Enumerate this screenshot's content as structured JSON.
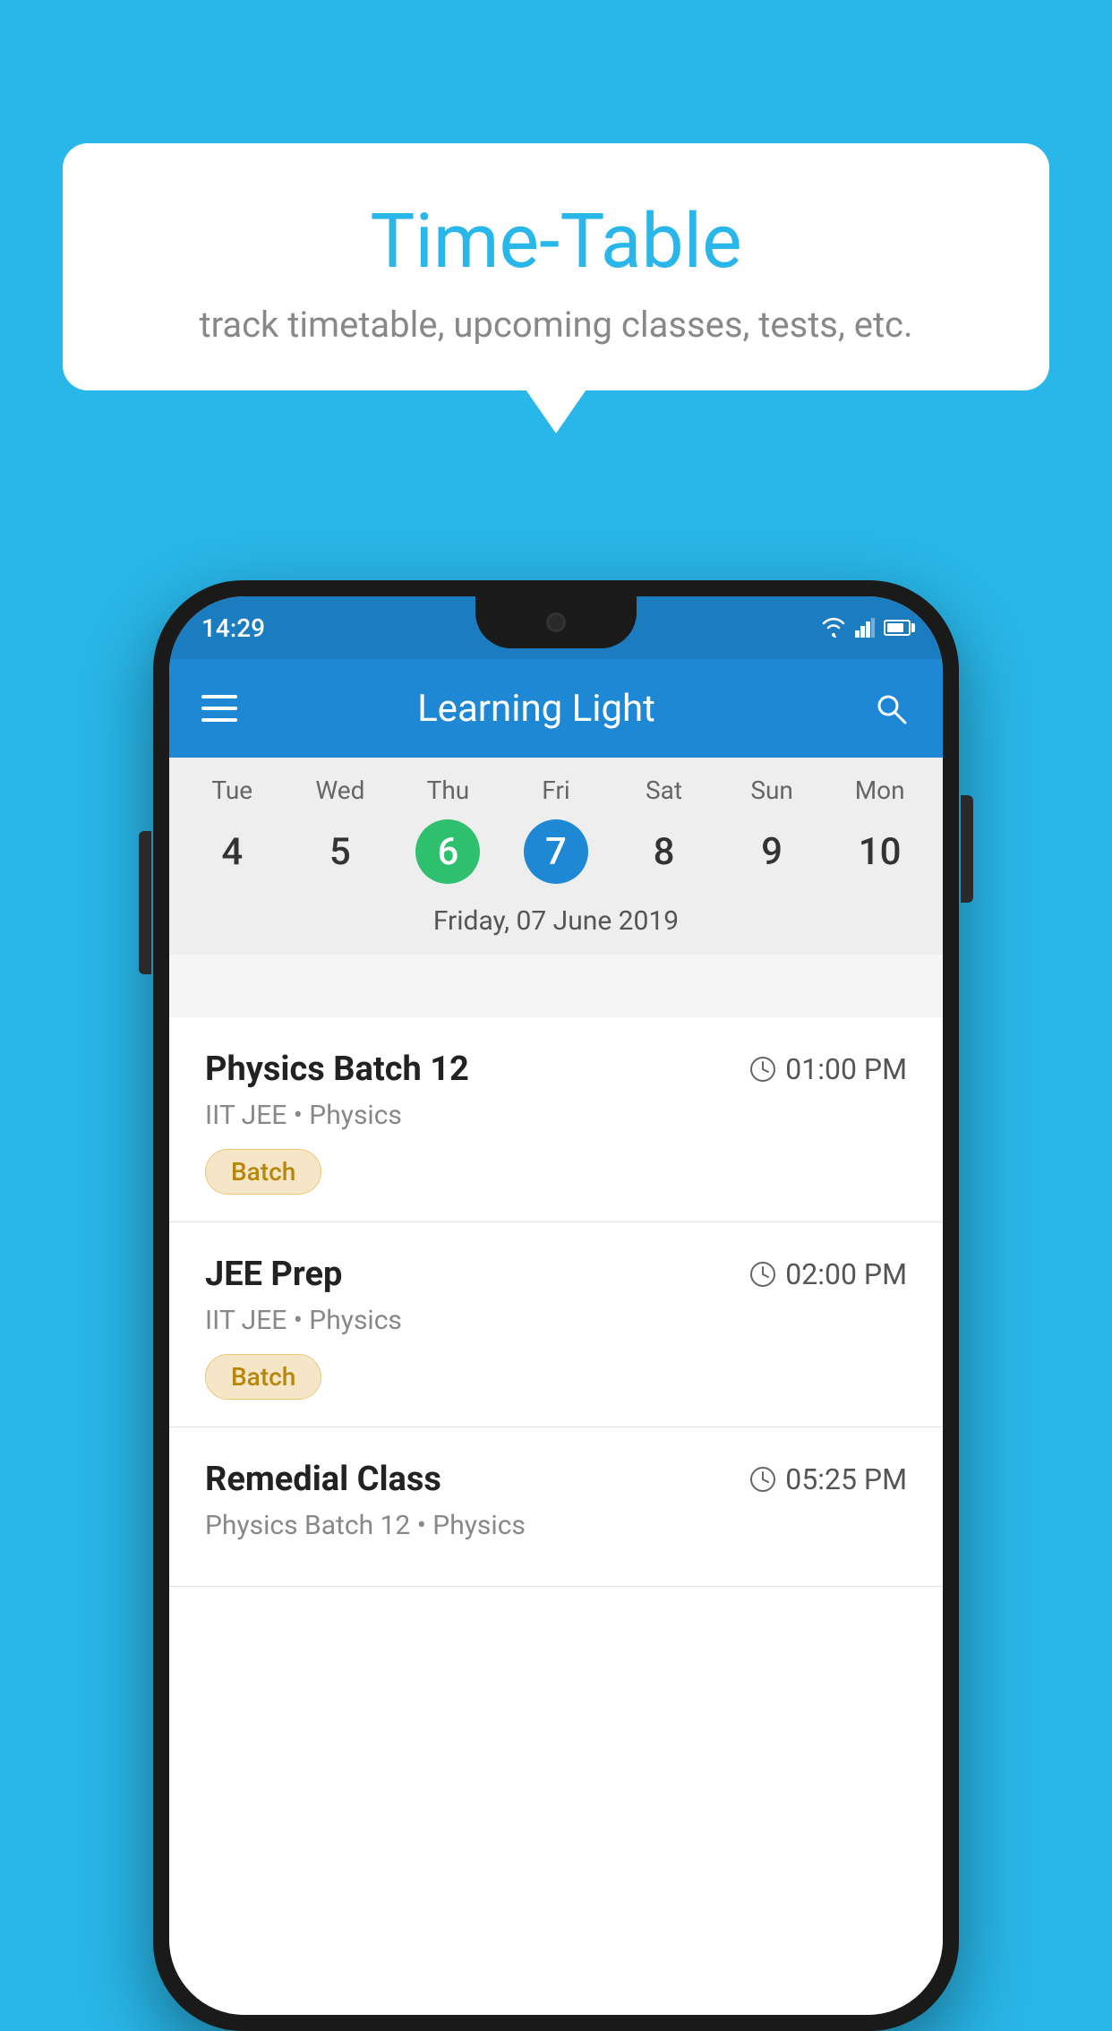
{
  "background_color": "#29b6e8",
  "callout": {
    "title": "Time-Table",
    "subtitle": "track timetable, upcoming classes, tests, etc."
  },
  "status_bar": {
    "time": "14:29"
  },
  "app_bar": {
    "title": "Learning Light"
  },
  "calendar": {
    "selected_date_label": "Friday, 07 June 2019",
    "days": [
      {
        "label": "Tue",
        "num": "4",
        "state": "normal"
      },
      {
        "label": "Wed",
        "num": "5",
        "state": "normal"
      },
      {
        "label": "Thu",
        "num": "6",
        "state": "today"
      },
      {
        "label": "Fri",
        "num": "7",
        "state": "selected"
      },
      {
        "label": "Sat",
        "num": "8",
        "state": "normal"
      },
      {
        "label": "Sun",
        "num": "9",
        "state": "normal"
      },
      {
        "label": "Mon",
        "num": "10",
        "state": "normal"
      }
    ]
  },
  "schedule": [
    {
      "title": "Physics Batch 12",
      "time": "01:00 PM",
      "subtitle": "IIT JEE • Physics",
      "badge": "Batch"
    },
    {
      "title": "JEE Prep",
      "time": "02:00 PM",
      "subtitle": "IIT JEE • Physics",
      "badge": "Batch"
    },
    {
      "title": "Remedial Class",
      "time": "05:25 PM",
      "subtitle": "Physics Batch 12 • Physics",
      "badge": null
    }
  ],
  "icons": {
    "hamburger": "☰",
    "search": "🔍",
    "clock": "🕐"
  }
}
